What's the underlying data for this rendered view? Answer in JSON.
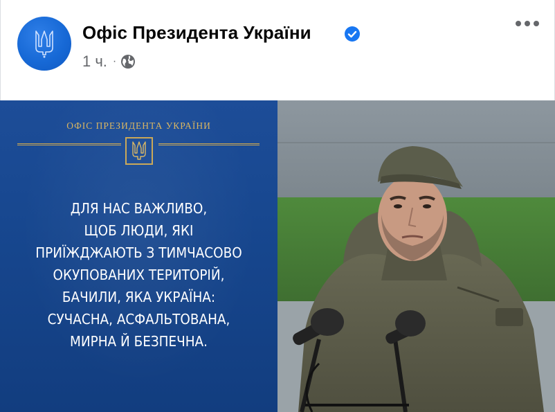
{
  "post": {
    "page_name": "Офіс Президента України",
    "time": "1 ч.",
    "separator": "·",
    "privacy_icon": "globe-icon",
    "verified_icon": "verified-badge-icon",
    "more_icon": "more-options-icon",
    "avatar_icon": "trident-icon"
  },
  "image": {
    "office_label": "ОФІС ПРЕЗИДЕНТА УКРАЇНИ",
    "quote_lines": [
      "ДЛЯ НАС ВАЖЛИВО,",
      "ЩОБ ЛЮДИ, ЯКІ",
      "ПРИЇЖДЖАЮТЬ З ТИМЧАСОВО",
      "ОКУПОВАНИХ ТЕРИТОРІЙ,",
      "БАЧИЛИ, ЯКА УКРАЇНА:",
      "СУЧАСНА, АСФАЛЬТОВАНА,",
      "МИРНА Й БЕЗПЕЧНА."
    ]
  },
  "colors": {
    "panel_blue": "#1a4a93",
    "gold": "#c9a653",
    "facebook_blue": "#1877f2",
    "secondary_text": "#65676b"
  }
}
